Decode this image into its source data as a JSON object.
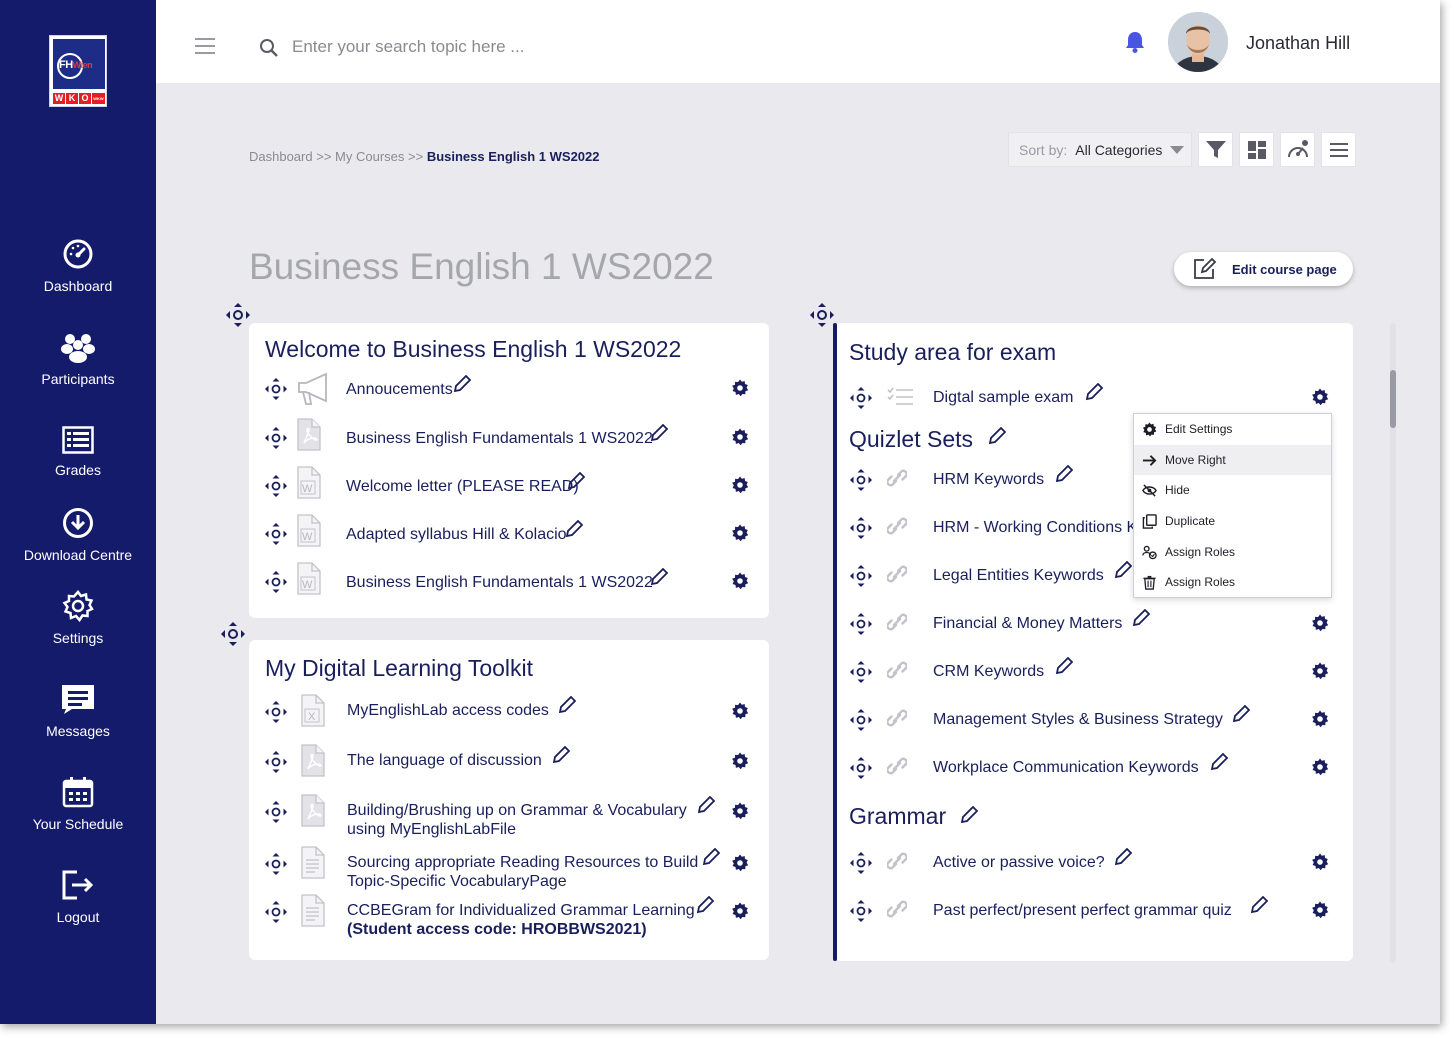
{
  "sidebar": {
    "items": [
      {
        "label": "Dashboard",
        "icon": "dashboard-gauge-icon"
      },
      {
        "label": "Participants",
        "icon": "participants-icon"
      },
      {
        "label": "Grades",
        "icon": "grades-icon"
      },
      {
        "label": "Download Centre",
        "icon": "download-icon"
      },
      {
        "label": "Settings",
        "icon": "gear-icon"
      },
      {
        "label": "Messages",
        "icon": "messages-icon"
      },
      {
        "label": "Your Schedule",
        "icon": "calendar-icon"
      },
      {
        "label": "Logout",
        "icon": "logout-icon"
      }
    ]
  },
  "header": {
    "search_placeholder": "Enter your search topic here ...",
    "user_name": "Jonathan Hill"
  },
  "breadcrumb": {
    "part1": "Dashboard",
    "sep1": " >> ",
    "part2": "My Courses",
    "sep2": " >> ",
    "current": "Business English 1 WS2022"
  },
  "toolbar": {
    "sort_label": "Sort by:",
    "sort_value": "All Categories"
  },
  "page_title": "Business English 1 WS2022",
  "edit_page_label": "Edit course page",
  "welcome": {
    "title": "Welcome to Business English 1 WS2022",
    "items": [
      {
        "label": "Annoucements",
        "type": "announcement"
      },
      {
        "label": "Business English Fundamentals 1 WS2022",
        "type": "pdf"
      },
      {
        "label": "Welcome letter (PLEASE READ)",
        "type": "word"
      },
      {
        "label": "Adapted syllabus Hill & Kolacio",
        "type": "word"
      },
      {
        "label": "Business English Fundamentals 1 WS2022",
        "type": "word"
      }
    ]
  },
  "toolkit": {
    "title": "My Digital Learning Toolkit",
    "items": [
      {
        "label": "MyEnglishLab access codes",
        "type": "excel"
      },
      {
        "label": "The language of discussion",
        "type": "pdf"
      },
      {
        "label": "Building/Brushing up on Grammar & Vocabulary",
        "label2": "using MyEnglishLabFile",
        "type": "pdf"
      },
      {
        "label": "Sourcing appropriate Reading Resources to Build",
        "label2": "Topic-Specific VocabularyPage",
        "type": "page"
      },
      {
        "label": "CCBEGram for Individualized Grammar Learning",
        "label2": "(Student access code: HROBBWS2021)",
        "type": "page"
      }
    ]
  },
  "study": {
    "title": "Study area for exam",
    "items": [
      {
        "label": "Digtal sample exam",
        "type": "quiz"
      }
    ]
  },
  "quizlet": {
    "title": "Quizlet Sets",
    "items": [
      {
        "label": "HRM Keywords"
      },
      {
        "label": "HRM - Working Conditions Keywords"
      },
      {
        "label": "Legal Entities Keywords"
      },
      {
        "label": "Financial & Money Matters"
      },
      {
        "label": "CRM Keywords"
      },
      {
        "label": "Management Styles & Business Strategy"
      },
      {
        "label": "Workplace Communication Keywords"
      }
    ]
  },
  "grammar": {
    "title": "Grammar",
    "items": [
      {
        "label": "Active or passive voice?"
      },
      {
        "label": "Past perfect/present perfect grammar quiz"
      }
    ]
  },
  "context_menu": {
    "items": [
      {
        "label": "Edit Settings",
        "icon": "gear-icon"
      },
      {
        "label": "Move Right",
        "icon": "arrow-right-icon"
      },
      {
        "label": "Hide",
        "icon": "eye-off-icon"
      },
      {
        "label": "Duplicate",
        "icon": "duplicate-icon"
      },
      {
        "label": "Assign Roles",
        "icon": "assign-roles-icon"
      },
      {
        "label": "Assign Roles",
        "icon": "trash-icon"
      }
    ]
  },
  "colors": {
    "sidebar": "#151b6b",
    "accent": "#1a1f5c",
    "background": "#e9e9ee",
    "bell": "#4a56e2"
  }
}
